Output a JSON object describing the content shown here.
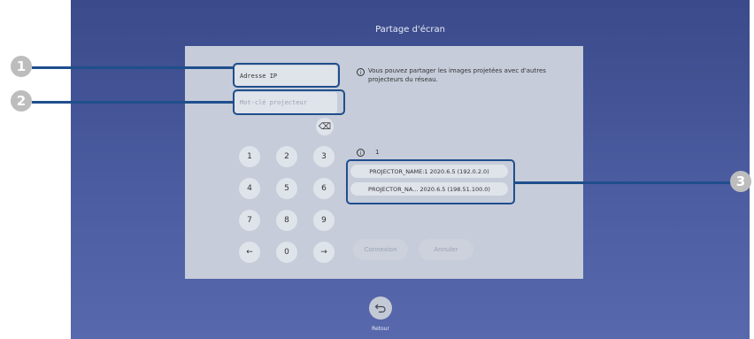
{
  "title": "Partage d'écran",
  "ip_field": {
    "value": "Adresse IP"
  },
  "keyword_field": {
    "placeholder": "Mot-clé projecteur"
  },
  "info_message": "Vous pouvez partager les images projetées avec d'autres projecteurs du réseau.",
  "projector_count": "1",
  "keypad": {
    "k1": "1",
    "k2": "2",
    "k3": "3",
    "k4": "4",
    "k5": "5",
    "k6": "6",
    "k7": "7",
    "k8": "8",
    "k9": "9",
    "k0": "0",
    "left": "←",
    "right": "→",
    "backspace": "⌫"
  },
  "projectors": [
    {
      "label": "PROJECTOR_NAME:1  2020.6.5 (192.0.2.0)"
    },
    {
      "label": "PROJECTOR_NA...  2020.6.5 (198.51.100.0)"
    }
  ],
  "buttons": {
    "connect": "Connexion",
    "cancel": "Annuler"
  },
  "back_label": "Retour",
  "callouts": {
    "c1": "1",
    "c2": "2",
    "c3": "3"
  }
}
